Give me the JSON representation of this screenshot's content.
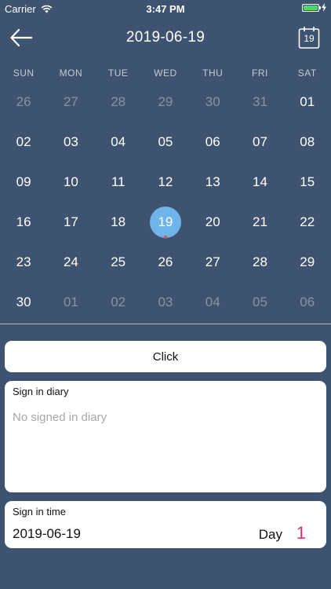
{
  "status_bar": {
    "carrier": "Carrier",
    "time": "3:47 PM",
    "battery_level": 1.0
  },
  "nav": {
    "title": "2019-06-19",
    "back_icon": "arrow-left-icon",
    "calendar_icon": "calendar-today-icon",
    "calendar_icon_number": "19"
  },
  "calendar": {
    "weekdays": [
      "SUN",
      "MON",
      "TUE",
      "WED",
      "THU",
      "FRI",
      "SAT"
    ],
    "weeks": [
      [
        {
          "d": "26",
          "o": true
        },
        {
          "d": "27",
          "o": true
        },
        {
          "d": "28",
          "o": true
        },
        {
          "d": "29",
          "o": true
        },
        {
          "d": "30",
          "o": true
        },
        {
          "d": "31",
          "o": true
        },
        {
          "d": "01",
          "o": false
        }
      ],
      [
        {
          "d": "02",
          "o": false
        },
        {
          "d": "03",
          "o": false
        },
        {
          "d": "04",
          "o": false
        },
        {
          "d": "05",
          "o": false
        },
        {
          "d": "06",
          "o": false
        },
        {
          "d": "07",
          "o": false
        },
        {
          "d": "08",
          "o": false
        }
      ],
      [
        {
          "d": "09",
          "o": false
        },
        {
          "d": "10",
          "o": false
        },
        {
          "d": "11",
          "o": false
        },
        {
          "d": "12",
          "o": false
        },
        {
          "d": "13",
          "o": false
        },
        {
          "d": "14",
          "o": false
        },
        {
          "d": "15",
          "o": false
        }
      ],
      [
        {
          "d": "16",
          "o": false
        },
        {
          "d": "17",
          "o": false
        },
        {
          "d": "18",
          "o": false
        },
        {
          "d": "19",
          "o": false,
          "selected": true,
          "marked": true
        },
        {
          "d": "20",
          "o": false
        },
        {
          "d": "21",
          "o": false
        },
        {
          "d": "22",
          "o": false
        }
      ],
      [
        {
          "d": "23",
          "o": false
        },
        {
          "d": "24",
          "o": false
        },
        {
          "d": "25",
          "o": false
        },
        {
          "d": "26",
          "o": false
        },
        {
          "d": "27",
          "o": false
        },
        {
          "d": "28",
          "o": false
        },
        {
          "d": "29",
          "o": false
        }
      ],
      [
        {
          "d": "30",
          "o": false
        },
        {
          "d": "01",
          "o": true
        },
        {
          "d": "02",
          "o": true
        },
        {
          "d": "03",
          "o": true
        },
        {
          "d": "04",
          "o": true
        },
        {
          "d": "05",
          "o": true
        },
        {
          "d": "06",
          "o": true
        }
      ]
    ]
  },
  "click_button": {
    "label": "Click"
  },
  "diary": {
    "title": "Sign in diary",
    "empty_text": "No signed in diary"
  },
  "sign_in_time": {
    "title": "Sign in time",
    "date": "2019-06-19",
    "day_label": "Day",
    "day_count": "1"
  },
  "colors": {
    "background": "#3e5370",
    "selected_day": "#6fb4e8",
    "marker_dot": "#e8455a",
    "day_count": "#e0306a"
  }
}
